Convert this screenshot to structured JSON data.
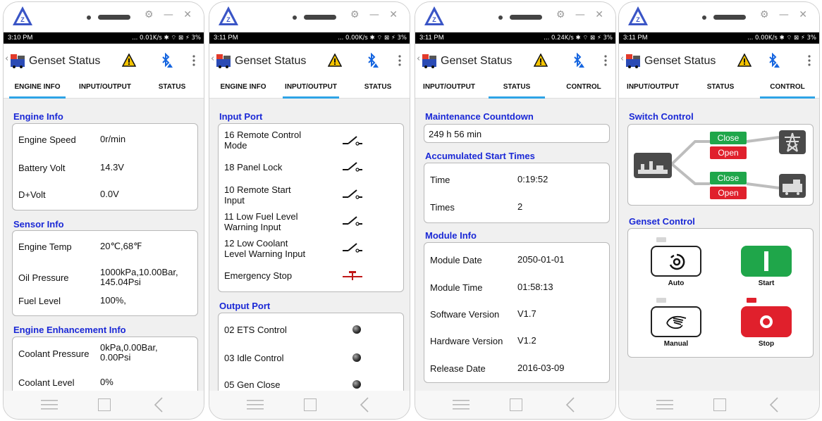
{
  "app": {
    "title": "Genset Status",
    "window_controls": "⚙ — ✕"
  },
  "screens": [
    {
      "time": "3:10 PM",
      "net": "... 0.01K/s ✱ ⌔ ⊠ ⚡ 3%",
      "tabs": [
        "ENGINE INFO",
        "INPUT/OUTPUT",
        "STATUS"
      ],
      "active_tab": 0,
      "engine_info": {
        "title": "Engine Info",
        "rows": [
          {
            "label": "Engine Speed",
            "value": "0r/min"
          },
          {
            "label": "Battery Volt",
            "value": "14.3V"
          },
          {
            "label": "D+Volt",
            "value": "0.0V"
          }
        ]
      },
      "sensor_info": {
        "title": "Sensor Info",
        "rows": [
          {
            "label": "Engine Temp",
            "value": "20℃,68℉"
          },
          {
            "label": "Oil Pressure",
            "value": "1000kPa,10.00Bar,\n145.04Psi"
          },
          {
            "label": "Fuel Level",
            "value": "100%,"
          }
        ]
      },
      "enhancement_info": {
        "title": "Engine Enhancement Info",
        "rows": [
          {
            "label": "Coolant Pressure",
            "value": "0kPa,0.00Bar,\n0.00Psi"
          },
          {
            "label": "Coolant Level",
            "value": "0%"
          }
        ]
      }
    },
    {
      "time": "3:11 PM",
      "net": "... 0.00K/s ✱ ⌔ ⊠ ⚡ 3%",
      "tabs": [
        "ENGINE INFO",
        "INPUT/OUTPUT",
        "STATUS"
      ],
      "active_tab": 1,
      "input_port": {
        "title": "Input Port",
        "rows": [
          {
            "label": "16 Remote Control\nMode",
            "icon": "switch-open-icon"
          },
          {
            "label": "18 Panel Lock",
            "icon": "switch-open-icon"
          },
          {
            "label": "10 Remote Start\nInput",
            "icon": "switch-open-icon"
          },
          {
            "label": "11 Low Fuel Level\nWarning Input",
            "icon": "switch-open-icon"
          },
          {
            "label": "12 Low Coolant\nLevel Warning Input",
            "icon": "switch-open-icon"
          },
          {
            "label": "Emergency Stop",
            "icon": "emergency-switch-icon"
          }
        ]
      },
      "output_port": {
        "title": "Output Port",
        "rows": [
          {
            "label": "02 ETS Control",
            "icon": "led-off-icon"
          },
          {
            "label": "03 Idle Control",
            "icon": "led-off-icon"
          },
          {
            "label": "05 Gen Close",
            "icon": "led-off-icon"
          }
        ]
      }
    },
    {
      "time": "3:11 PM",
      "net": "... 0.24K/s ✱ ⌔ ⊠ ⚡ 3%",
      "tabs": [
        "INPUT/OUTPUT",
        "STATUS",
        "CONTROL"
      ],
      "active_tab": 1,
      "maintenance": {
        "title": "Maintenance Countdown",
        "value": "249 h 56 min"
      },
      "start_times": {
        "title": "Accumulated Start Times",
        "rows": [
          {
            "label": "Time",
            "value": "0:19:52"
          },
          {
            "label": "Times",
            "value": "2"
          }
        ]
      },
      "module_info": {
        "title": "Module Info",
        "rows": [
          {
            "label": "Module Date",
            "value": "2050-01-01"
          },
          {
            "label": "Module Time",
            "value": "01:58:13"
          },
          {
            "label": "Software Version",
            "value": "V1.7"
          },
          {
            "label": "Hardware Version",
            "value": "V1.2"
          },
          {
            "label": "Release Date",
            "value": "2016-03-09"
          }
        ]
      }
    },
    {
      "time": "3:11 PM",
      "net": "... 0.00K/s ✱ ⌔ ⊠ ⚡ 3%",
      "tabs": [
        "INPUT/OUTPUT",
        "STATUS",
        "CONTROL"
      ],
      "active_tab": 2,
      "switch_control": {
        "title": "Switch Control",
        "mains": {
          "close": "Close",
          "open": "Open"
        },
        "gen": {
          "close": "Close",
          "open": "Open"
        }
      },
      "genset_control": {
        "title": "Genset Control",
        "auto": "Auto",
        "start": "Start",
        "manual": "Manual",
        "stop": "Stop"
      }
    }
  ],
  "colors": {
    "section_title": "#1a28d6",
    "tab_indicator": "#2ea3e6",
    "green": "#1fa64a",
    "red": "#e0202c"
  }
}
